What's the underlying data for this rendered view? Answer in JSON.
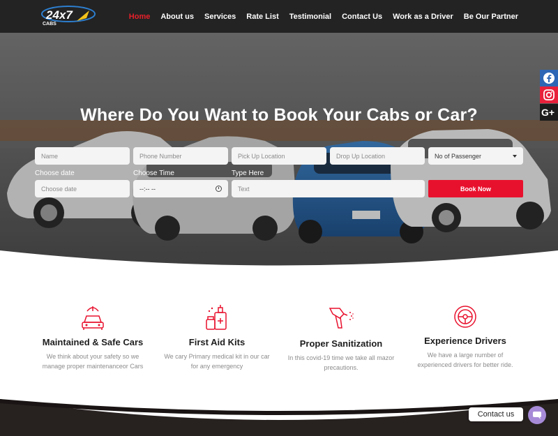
{
  "nav": {
    "logo_text": "24x7",
    "logo_sub": "CABS",
    "items": [
      {
        "label": "Home",
        "active": true
      },
      {
        "label": "About us"
      },
      {
        "label": "Services"
      },
      {
        "label": "Rate List"
      },
      {
        "label": "Testimonial"
      },
      {
        "label": "Contact Us"
      },
      {
        "label": "Work as a Driver"
      },
      {
        "label": "Be Our Partner"
      }
    ]
  },
  "hero": {
    "title": "Where Do You Want to Book Your Cabs or Car?",
    "form": {
      "name_placeholder": "Name",
      "phone_placeholder": "Phone Number",
      "pickup_placeholder": "Pick Up Location",
      "drop_placeholder": "Drop Up Location",
      "passenger_selected": "No of Passenger",
      "date_label": "Choose date",
      "date_placeholder": "Choose date",
      "time_label": "Choose Time",
      "time_value": "--:-- --",
      "text_label": "Type Here",
      "text_placeholder": "Text",
      "book_label": "Book Now"
    }
  },
  "social": [
    "facebook-icon",
    "instagram-icon",
    "google-plus-icon"
  ],
  "features": [
    {
      "title": "Maintained & Safe Cars",
      "text": "We think about your safety so we manage proper maintenanceor Cars",
      "icon": "car-wash-icon"
    },
    {
      "title": "First Aid Kits",
      "text": "We cary Primary medical kit in our car for any emergency",
      "icon": "sanitizer-bottles-icon"
    },
    {
      "title": "Proper Sanitization",
      "text": "In this covid-19 time we take all mazor precautions.",
      "icon": "spray-gun-icon"
    },
    {
      "title": "Experience Drivers",
      "text": "We have a large number of experienced drivers for better ride.",
      "icon": "steering-wheel-icon"
    }
  ],
  "contact": {
    "label": "Contact us"
  },
  "colors": {
    "accent": "#e8112d",
    "nav_bg": "#232323",
    "facebook": "#2d66b5",
    "instagram": "#e8213b"
  }
}
